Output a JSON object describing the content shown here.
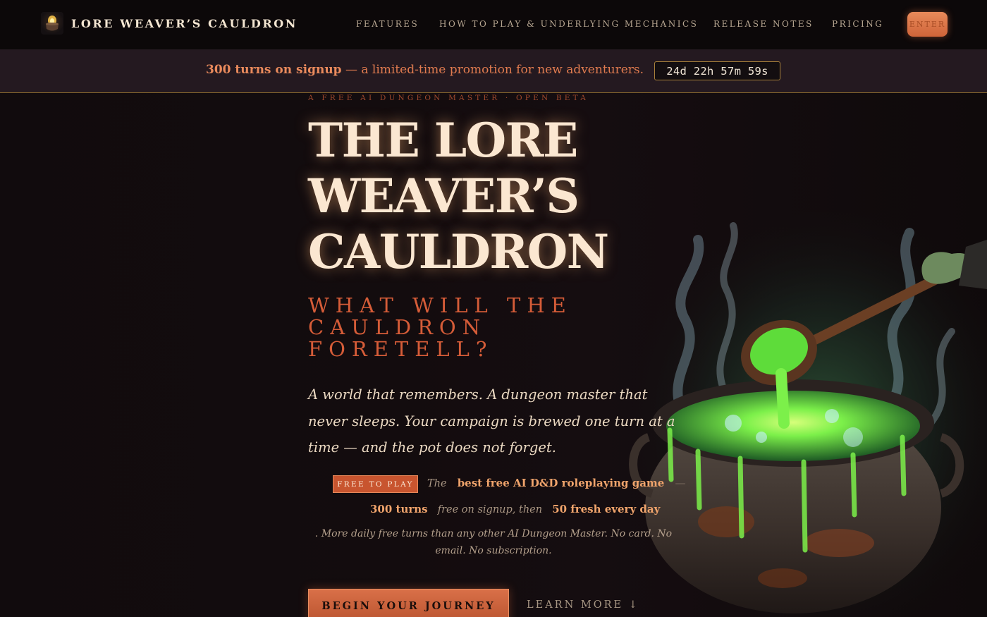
{
  "nav": {
    "brand": "LORE WEAVER’S CAULDRON",
    "links": [
      "FEATURES",
      "HOW TO PLAY & UNDERLYING MECHANICS",
      "RELEASE NOTES",
      "PRICING"
    ],
    "enter_label": "ENTER"
  },
  "promo": {
    "strong": "300 turns on signup",
    "rest": " — a limited-time promotion for new adventurers.",
    "timer": "24d 22h 57m 59s"
  },
  "hero": {
    "eyebrow": "A FREE AI DUNGEON MASTER · OPEN BETA",
    "title_line1": "THE LORE",
    "title_line2": "WEAVER’S",
    "title_line3": "CAULDRON",
    "tagline": "WHAT WILL THE CAULDRON FORETELL?",
    "lede": "A world that remembers. A dungeon master that never sleeps. Your campaign is brewed one turn at a time — and the pot does not forget.",
    "badge": "FREE TO PLAY",
    "line1_prefix": "The",
    "line1_highlight": "best free AI D&D roleplaying game",
    "line1_suffix": "—",
    "line2_highlight_a": "300 turns",
    "line2_middle": "free on signup, then",
    "line2_highlight_b": "50 fresh every day",
    "fineprint": ". More daily free turns than any other AI Dungeon Master. No card. No email. No subscription.",
    "cta_label": "BEGIN YOUR JOURNEY",
    "learn_more": "LEARN MORE ↓"
  },
  "colors": {
    "accent": "#d55c38",
    "background": "#0f0a0c",
    "promo_bg": "#241920",
    "potion_green": "#7cf04a"
  },
  "icons": {
    "brand": "cauldron-icon"
  }
}
